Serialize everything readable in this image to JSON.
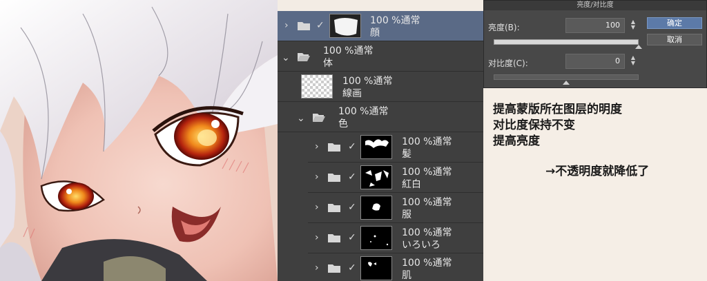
{
  "layers": [
    {
      "id": "face",
      "opacity_mode": "100 %通常",
      "name": "顔",
      "has_chevron": true,
      "chevron": "›",
      "checked": true,
      "selected": true
    },
    {
      "id": "body",
      "opacity_mode": "100 %通常",
      "name": "体",
      "has_chevron": true,
      "chevron": "⌄",
      "checked": false,
      "selected": false
    },
    {
      "id": "lineart",
      "opacity_mode": "100 %通常",
      "name": "線画",
      "has_chevron": false,
      "checked": false,
      "selected": false
    },
    {
      "id": "color",
      "opacity_mode": "100 %通常",
      "name": "色",
      "has_chevron": true,
      "chevron": "⌄",
      "checked": false,
      "selected": false
    },
    {
      "id": "hair",
      "opacity_mode": "100 %通常",
      "name": "髪",
      "has_chevron": true,
      "chevron": "›",
      "checked": true,
      "selected": false
    },
    {
      "id": "red-white",
      "opacity_mode": "100 %通常",
      "name": "紅白",
      "has_chevron": true,
      "chevron": "›",
      "checked": true,
      "selected": false
    },
    {
      "id": "clothes",
      "opacity_mode": "100 %通常",
      "name": "服",
      "has_chevron": true,
      "chevron": "›",
      "checked": true,
      "selected": false
    },
    {
      "id": "misc",
      "opacity_mode": "100 %通常",
      "name": "いろいろ",
      "has_chevron": true,
      "chevron": "›",
      "checked": true,
      "selected": false
    },
    {
      "id": "skin",
      "opacity_mode": "100 %通常",
      "name": "肌",
      "has_chevron": true,
      "chevron": "›",
      "checked": true,
      "selected": false
    }
  ],
  "dialog": {
    "title": "亮度/对比度",
    "brightness_label": "亮度(B):",
    "brightness_value": "100",
    "brightness_level": 1.0,
    "contrast_label": "对比度(C):",
    "contrast_value": "0",
    "contrast_level": 0.5,
    "ok_label": "确定",
    "cancel_label": "取消"
  },
  "notes": {
    "line1": "提高蒙版所在图层的明度",
    "line2": "对比度保持不变",
    "line3": "提高亮度",
    "line4": "→不透明度就降低了"
  },
  "icons": {
    "folder": "folder-icon",
    "check": "check-icon",
    "chevron_right": "chevron-right-icon",
    "chevron_down": "chevron-down-icon",
    "spin": "spin-arrows-icon"
  },
  "colors": {
    "panel_bg": "#3f3f3f",
    "selected_row": "#5a6a86",
    "ok_button": "#5c7aa8",
    "note_bg": "#f5eee6"
  }
}
